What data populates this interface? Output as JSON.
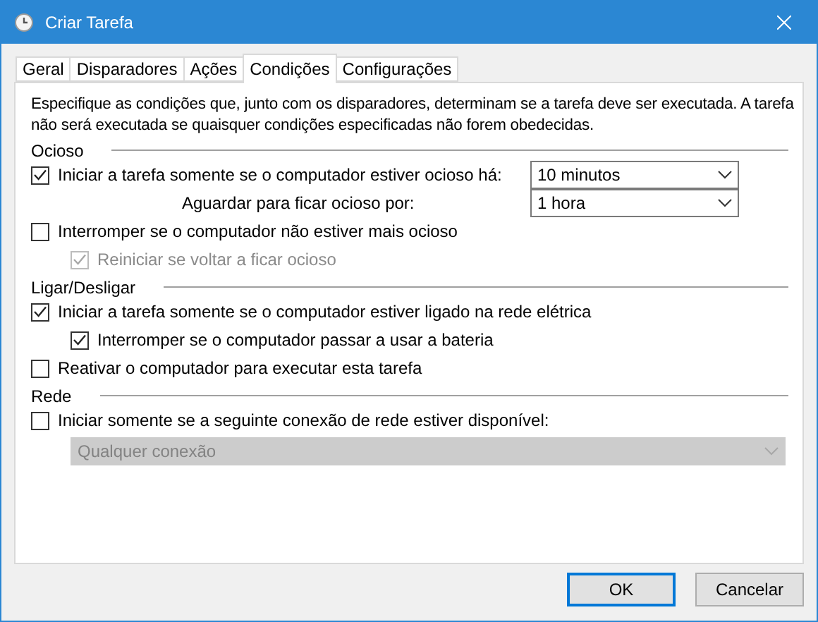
{
  "window": {
    "title": "Criar Tarefa"
  },
  "tabs": [
    {
      "label": "Geral",
      "selected": false
    },
    {
      "label": "Disparadores",
      "selected": false
    },
    {
      "label": "Ações",
      "selected": false
    },
    {
      "label": "Condições",
      "selected": true
    },
    {
      "label": "Configurações",
      "selected": false
    }
  ],
  "description": "Especifique as condições que, junto com os disparadores, determinam se a tarefa deve ser executada. A tarefa não será executada se quaisquer condições especificadas não forem obedecidas.",
  "sections": [
    {
      "title": "Ocioso",
      "rows": [
        {
          "kind": "checkbox",
          "label": "Iniciar a tarefa somente se o computador estiver ocioso há:",
          "checked": true,
          "disabled": false,
          "dropdown": {
            "value": "10 minutos",
            "disabled": false
          }
        },
        {
          "kind": "label",
          "label": "Aguardar para ficar ocioso por:",
          "dropdown": {
            "value": "1 hora",
            "disabled": false
          }
        },
        {
          "kind": "checkbox",
          "label": "Interromper se o computador não estiver mais ocioso",
          "checked": false,
          "disabled": false,
          "children": [
            {
              "kind": "checkbox",
              "label": "Reiniciar se voltar a ficar ocioso",
              "checked": true,
              "disabled": true
            }
          ]
        }
      ]
    },
    {
      "title": "Ligar/Desligar",
      "rows": [
        {
          "kind": "checkbox",
          "label": "Iniciar a tarefa somente se o computador estiver ligado na rede elétrica",
          "checked": true,
          "disabled": false,
          "children": [
            {
              "kind": "checkbox",
              "label": "Interromper se o computador passar a usar a bateria",
              "checked": true,
              "disabled": false
            }
          ]
        },
        {
          "kind": "checkbox",
          "label": "Reativar o computador para executar esta tarefa",
          "checked": false,
          "disabled": false
        }
      ]
    },
    {
      "title": "Rede",
      "rows": [
        {
          "kind": "checkbox",
          "label": "Iniciar somente se a seguinte conexão de rede estiver disponível:",
          "checked": false,
          "disabled": false,
          "children": [
            {
              "kind": "dropdown",
              "dropdown": {
                "value": "Qualquer conexão",
                "disabled": true
              }
            }
          ]
        }
      ]
    }
  ],
  "buttons": [
    {
      "label": "OK",
      "default": true
    },
    {
      "label": "Cancelar",
      "default": false
    }
  ]
}
